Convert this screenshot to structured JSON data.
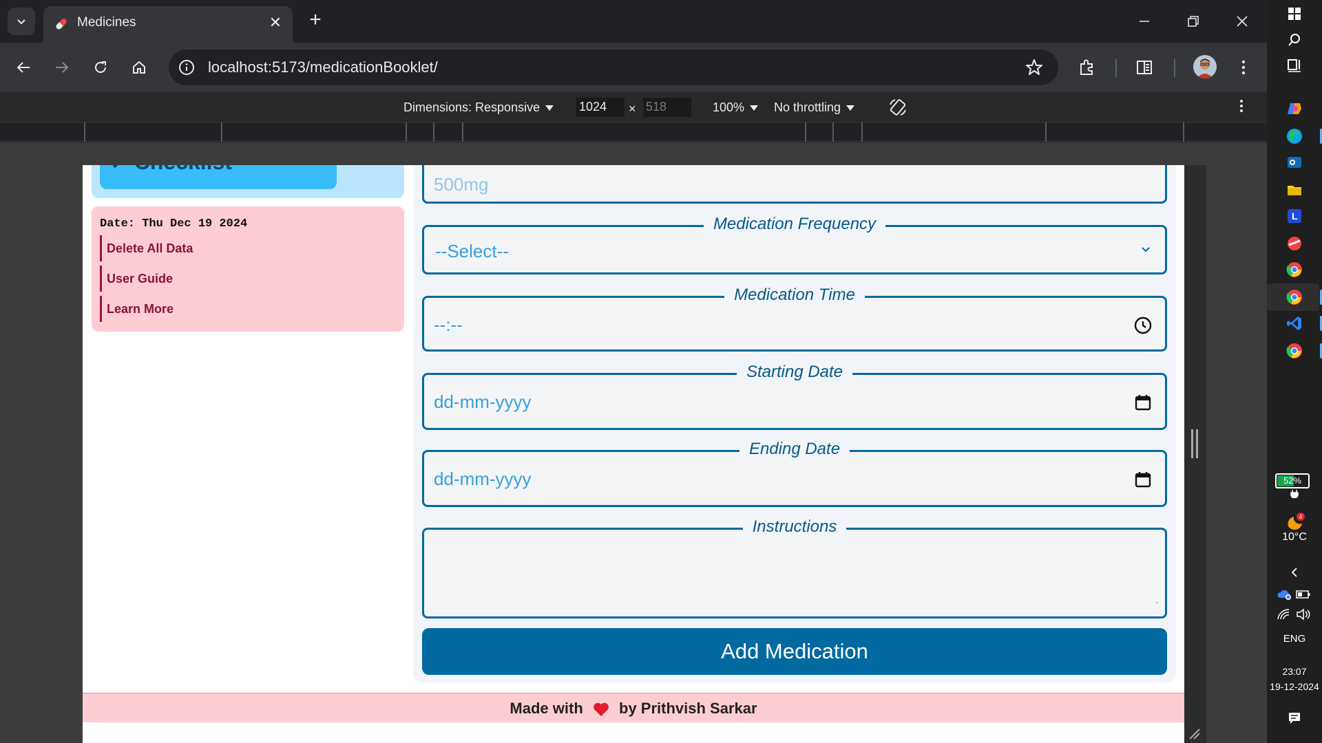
{
  "browser": {
    "tab_title": "Medicines",
    "url_host": "localhost",
    "url_path": ":5173/medicationBooklet/"
  },
  "devtools": {
    "dimensions_label": "Dimensions: Responsive",
    "width_value": "1024",
    "times": "×",
    "height_value": "518",
    "zoom": "100%",
    "throttling": "No throttling"
  },
  "sidebar": {
    "checklist_label": "✓ Checklist",
    "date_text": "Date: Thu Dec 19 2024",
    "links": [
      "Delete All Data",
      "User Guide",
      "Learn More"
    ]
  },
  "form": {
    "dosage_value": "500mg",
    "frequency_label": "Medication Frequency",
    "frequency_value": "--Select--",
    "time_label": "Medication Time",
    "time_value": "--:--",
    "start_label": "Starting Date",
    "start_value": "dd-mm-yyyy",
    "end_label": "Ending Date",
    "end_value": "dd-mm-yyyy",
    "instructions_label": "Instructions",
    "instructions_value": "",
    "submit_label": "Add Medication"
  },
  "footer": {
    "prefix": "Made with",
    "suffix": "by Prithvish Sarkar"
  },
  "taskbar": {
    "battery": "52%",
    "weather_temp": "10°C",
    "weather_badge": "4",
    "language": "ENG",
    "time": "23:07",
    "date": "19-12-2024"
  },
  "colors": {
    "accent": "#0369a1",
    "footer_bg": "#fecdd3",
    "checklist_bg": "#38bdf8"
  }
}
